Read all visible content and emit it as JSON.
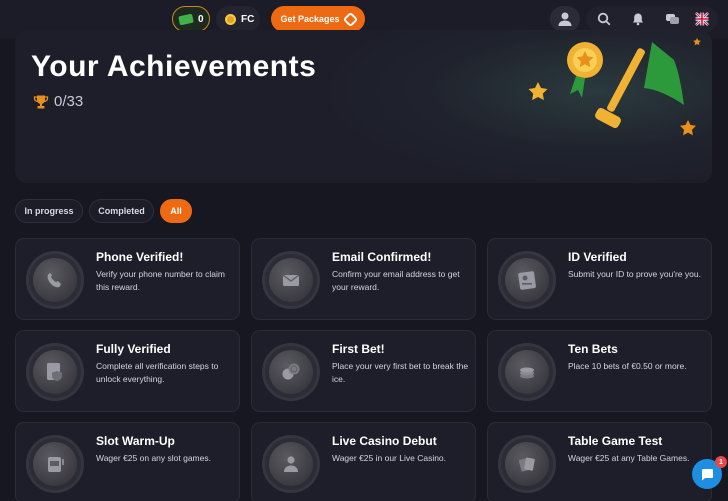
{
  "topbar": {
    "cash_balance": "0",
    "fc_label": "FC",
    "get_packages_label": "Get Packages",
    "icons": [
      "user-icon",
      "search-icon",
      "bell-icon",
      "chat-bubbles-icon",
      "uk-flag-icon"
    ]
  },
  "hero": {
    "title": "Your Achievements",
    "progress": "0/33"
  },
  "filters": [
    {
      "label": "In progress",
      "active": false
    },
    {
      "label": "Completed",
      "active": false
    },
    {
      "label": "All",
      "active": true
    }
  ],
  "achievements": [
    {
      "title": "Phone Verified!",
      "desc": "Verify your phone number to claim this reward.",
      "icon": "phone-icon"
    },
    {
      "title": "Email Confirmed!",
      "desc": "Confirm your email address to get your reward.",
      "icon": "envelope-icon"
    },
    {
      "title": "ID Verified",
      "desc": "Submit your ID to prove you're you.",
      "icon": "id-card-icon"
    },
    {
      "title": "Fully Verified",
      "desc": "Complete all verification steps to unlock everything.",
      "icon": "shield-document-icon"
    },
    {
      "title": "First Bet!",
      "desc": "Place your very first bet to break the ice.",
      "icon": "coins-icon"
    },
    {
      "title": "Ten Bets",
      "desc": "Place 10 bets of €0.50 or more.",
      "icon": "chips-icon"
    },
    {
      "title": "Slot Warm-Up",
      "desc": "Wager €25 on any slot games.",
      "icon": "slot-machine-icon"
    },
    {
      "title": "Live Casino Debut",
      "desc": "Wager €25 in our Live Casino.",
      "icon": "dealer-icon"
    },
    {
      "title": "Table Game Test",
      "desc": "Wager €25 at any Table Games.",
      "icon": "cards-icon"
    }
  ],
  "chat_unread": "1",
  "colors": {
    "accent": "#ee6a12",
    "background": "#161721",
    "card": "#1d1e29",
    "chat": "#1e8fe0"
  }
}
